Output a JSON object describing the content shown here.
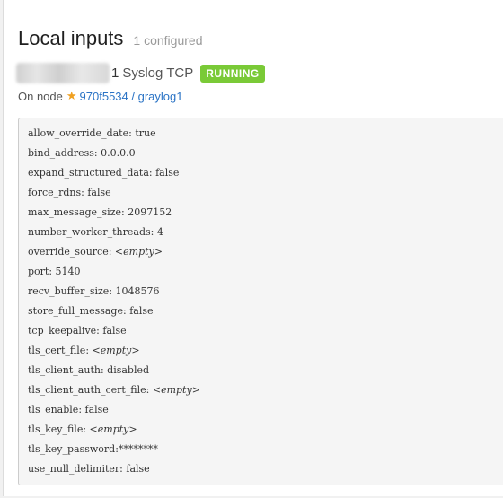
{
  "page": {
    "title": "Local inputs",
    "subtitle": "1 configured"
  },
  "input": {
    "name_suffix": "1",
    "type_label": "Syslog TCP",
    "status": "RUNNING"
  },
  "node": {
    "prefix": "On node",
    "star_icon": "star-icon",
    "link_text": "970f5534 / graylog1"
  },
  "colors": {
    "running_badge": "#7aca37",
    "link": "#2a73c5",
    "star": "#f0a020"
  },
  "config": [
    {
      "key": "allow_override_date",
      "sep": ": ",
      "value": "true"
    },
    {
      "key": "bind_address",
      "sep": ": ",
      "value": "0.0.0.0"
    },
    {
      "key": "expand_structured_data",
      "sep": ": ",
      "value": "false"
    },
    {
      "key": "force_rdns",
      "sep": ": ",
      "value": "false"
    },
    {
      "key": "max_message_size",
      "sep": ": ",
      "value": "2097152"
    },
    {
      "key": "number_worker_threads",
      "sep": ": ",
      "value": "4"
    },
    {
      "key": "override_source",
      "sep": ": ",
      "value": "<empty>"
    },
    {
      "key": "port",
      "sep": ": ",
      "value": "5140"
    },
    {
      "key": "recv_buffer_size",
      "sep": ": ",
      "value": "1048576"
    },
    {
      "key": "store_full_message",
      "sep": ": ",
      "value": "false"
    },
    {
      "key": "tcp_keepalive",
      "sep": ": ",
      "value": "false"
    },
    {
      "key": "tls_cert_file",
      "sep": ": ",
      "value": "<empty>"
    },
    {
      "key": "tls_client_auth",
      "sep": ": ",
      "value": "disabled"
    },
    {
      "key": "tls_client_auth_cert_file",
      "sep": ": ",
      "value": "<empty>"
    },
    {
      "key": "tls_enable",
      "sep": ": ",
      "value": "false"
    },
    {
      "key": "tls_key_file",
      "sep": ": ",
      "value": "<empty>"
    },
    {
      "key": "tls_key_password",
      "sep": ":",
      "value": "********"
    },
    {
      "key": "use_null_delimiter",
      "sep": ": ",
      "value": "false"
    }
  ]
}
